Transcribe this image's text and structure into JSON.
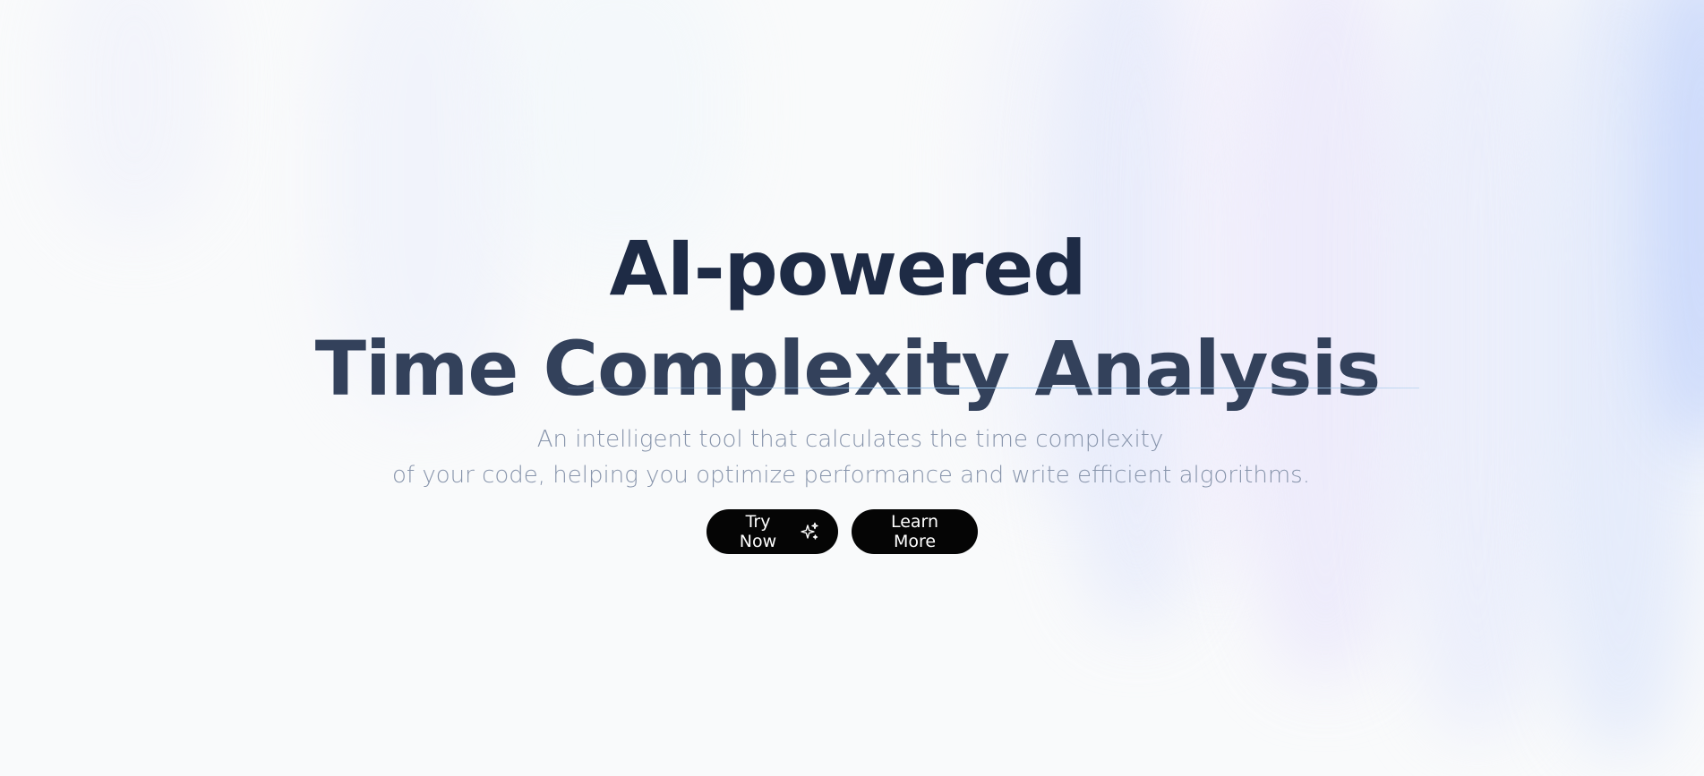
{
  "hero": {
    "title_line1": "AI-powered",
    "title_line2": "Time Complexity Analysis",
    "subtitle_line1": "An intelligent tool that calculates the time complexity",
    "subtitle_line2": "of your code, helping you optimize performance and write efficient algorithms."
  },
  "actions": {
    "try_now_label": "Try Now",
    "try_now_icon": "sparkles-icon",
    "learn_more_label": "Learn More"
  },
  "colors": {
    "title_primary": "#1e2b45",
    "title_secondary": "#33415b",
    "subtitle": "#8794ab",
    "button_bg": "#050505",
    "button_text": "#ffffff",
    "background": "#f9fafb"
  }
}
